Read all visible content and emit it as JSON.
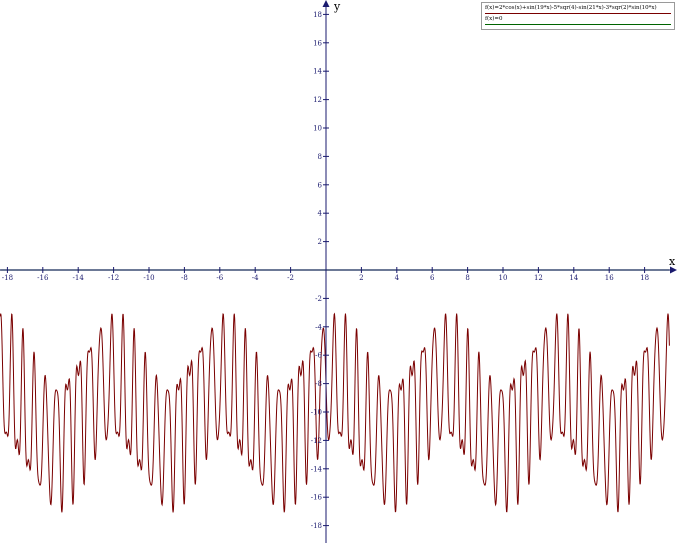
{
  "chart_data": {
    "type": "line",
    "title": "",
    "xlabel": "x",
    "ylabel": "y",
    "xlim": [
      -18.4,
      19.4
    ],
    "ylim": [
      -19,
      19
    ],
    "x_ticks": [
      "-18",
      "-16",
      "-14",
      "-12",
      "-10",
      "-8",
      "-6",
      "-4",
      "-2",
      "2",
      "4",
      "6",
      "8",
      "10",
      "12",
      "14",
      "16",
      "18"
    ],
    "y_ticks": [
      "18",
      "16",
      "14",
      "12",
      "10",
      "8",
      "6",
      "4",
      "2",
      "-2",
      "-4",
      "-6",
      "-8",
      "-10",
      "-12",
      "-14",
      "-16",
      "-18"
    ],
    "series": [
      {
        "name": "f(x)=2*cos(x)+sin(19*x)-5*sqr(4)-sin(21*x)-3*sqr(2)*sin(10*x)",
        "color": "#7a0000",
        "sampling": {
          "x_start": -18.4,
          "x_end": 19.4,
          "step": 0.02
        }
      },
      {
        "name": "f(x)=0",
        "color": "#006400",
        "points": [
          [
            -18.4,
            0
          ],
          [
            19.4,
            0
          ]
        ]
      }
    ],
    "grid": false,
    "legend_position": "top-right"
  },
  "colors": {
    "axis": "#1a1a6e",
    "curve": "#7a0000",
    "zero_line": "#006400"
  }
}
